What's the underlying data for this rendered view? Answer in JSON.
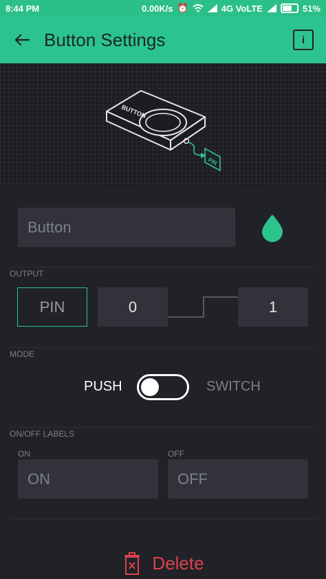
{
  "status_bar": {
    "time": "8:44 PM",
    "net_speed": "0.00K/s",
    "network": "4G VoLTE",
    "battery": "51%"
  },
  "app_bar": {
    "title": "Button Settings",
    "info_label": "i"
  },
  "illustration": {
    "device_label": "BUTTON",
    "pin_label": "PIN"
  },
  "name_field": {
    "value": "Button"
  },
  "colors": {
    "accent": "#2bc48f",
    "danger": "#d9434e",
    "field_bg": "#32333a"
  },
  "output": {
    "section_label": "OUTPUT",
    "pin_label": "PIN",
    "low_value": "0",
    "high_value": "1"
  },
  "mode": {
    "section_label": "MODE",
    "push_label": "PUSH",
    "switch_label": "SWITCH"
  },
  "labels": {
    "section_label": "ON/OFF LABELS",
    "on_caption": "ON",
    "off_caption": "OFF",
    "on_value": "ON",
    "off_value": "OFF"
  },
  "delete": {
    "label": "Delete"
  }
}
